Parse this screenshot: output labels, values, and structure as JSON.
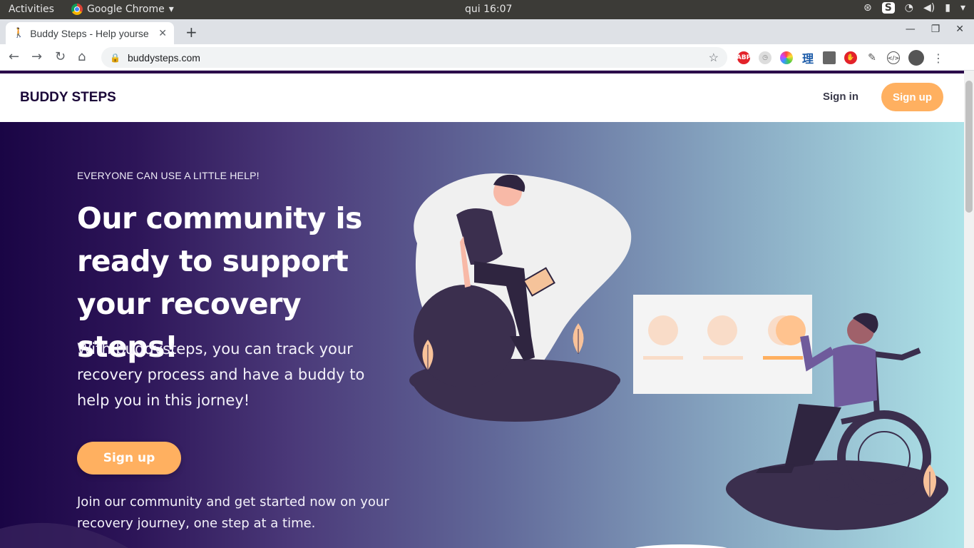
{
  "os_bar": {
    "activities": "Activities",
    "app_name": "Google Chrome",
    "clock": "qui 16:07"
  },
  "browser": {
    "tab_title": "Buddy Steps - Help yourse",
    "url": "buddysteps.com"
  },
  "site": {
    "brand": "BUDDY STEPS",
    "signin_label": "Sign in",
    "signup_label": "Sign up"
  },
  "hero": {
    "kicker": "EVERYONE CAN USE A LITTLE HELP!",
    "headline": "Our community is ready to support your recovery steps!",
    "description": "With buddysteps, you can track your recovery process and have a buddy to help you in this jorney!",
    "cta_label": "Sign up",
    "join_text": "Join our community and get started now on your recovery journey, one step at a time."
  },
  "colors": {
    "accent": "#ffb060",
    "brand_dark": "#1a0638",
    "gradient_start": "#1a0545",
    "gradient_end": "#aee3e8"
  }
}
